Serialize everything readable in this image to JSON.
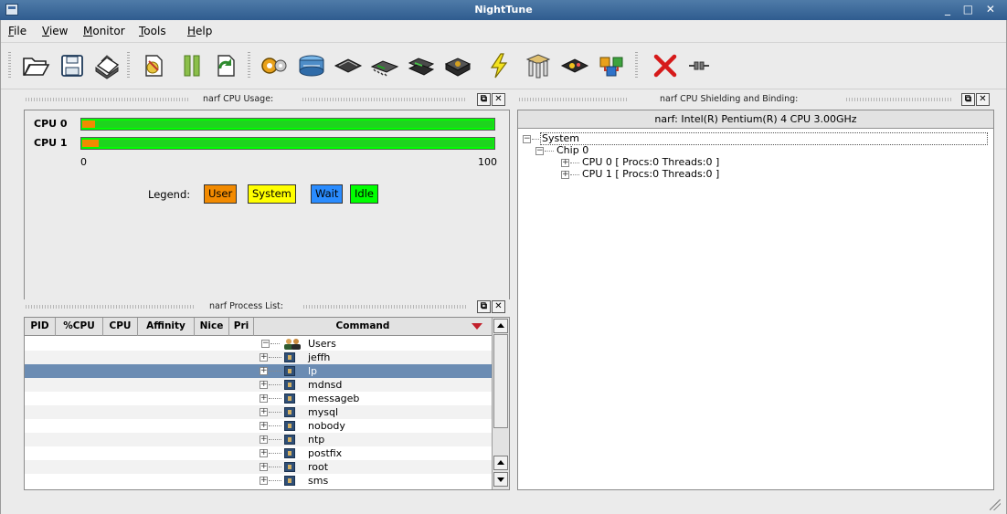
{
  "window": {
    "title": "NightTune",
    "controls": "_ □ ✕"
  },
  "menu": [
    "File",
    "View",
    "Monitor",
    "Tools",
    "Help"
  ],
  "toolbar_icons": [
    "open-icon",
    "save-icon",
    "print-icon",
    "export-icon",
    "pause-icon",
    "refresh-icon",
    "gear-icon",
    "disk-icon",
    "memory-icon",
    "chip-icon",
    "drive-icon",
    "lightning-icon",
    "network-icon",
    "card-icon",
    "interconnect-icon",
    "close-x-icon",
    "link-icon"
  ],
  "cpu_panel": {
    "title": "narf CPU Usage:",
    "cpus": [
      {
        "label": "CPU 0",
        "user": 3,
        "system": 0,
        "wait": 0,
        "idle": 97
      },
      {
        "label": "CPU 1",
        "user": 4,
        "system": 0,
        "wait": 0,
        "idle": 96
      }
    ],
    "axis_min": "0",
    "axis_max": "100",
    "legend_label": "Legend:",
    "legend": [
      {
        "label": "User",
        "color": "#f28a00"
      },
      {
        "label": "System",
        "color": "#ffff00"
      },
      {
        "label": "Wait",
        "color": "#2a8cff"
      },
      {
        "label": "Idle",
        "color": "#00ff00"
      }
    ]
  },
  "process_panel": {
    "title": "narf Process List:",
    "columns": [
      "PID",
      "%CPU",
      "CPU",
      "Affinity",
      "Nice",
      "Pri",
      "Command"
    ],
    "group": "Users",
    "rows": [
      "jeffh",
      "lp",
      "mdnsd",
      "messageb",
      "mysql",
      "nobody",
      "ntp",
      "postfix",
      "root",
      "sms"
    ],
    "selected_row": "lp"
  },
  "shield_panel": {
    "title": "narf CPU Shielding and Binding:",
    "header": "narf:  Intel(R) Pentium(R) 4 CPU 3.00GHz",
    "tree": {
      "root": "System",
      "chip": "Chip 0",
      "cpus": [
        "CPU 0  [ Procs:0 Threads:0 ]",
        "CPU 1  [ Procs:0 Threads:0 ]"
      ]
    }
  },
  "colors": {
    "titlebar": "#3a6595",
    "selection": "#6b8cb3",
    "sort_arrow": "#c2202b"
  }
}
